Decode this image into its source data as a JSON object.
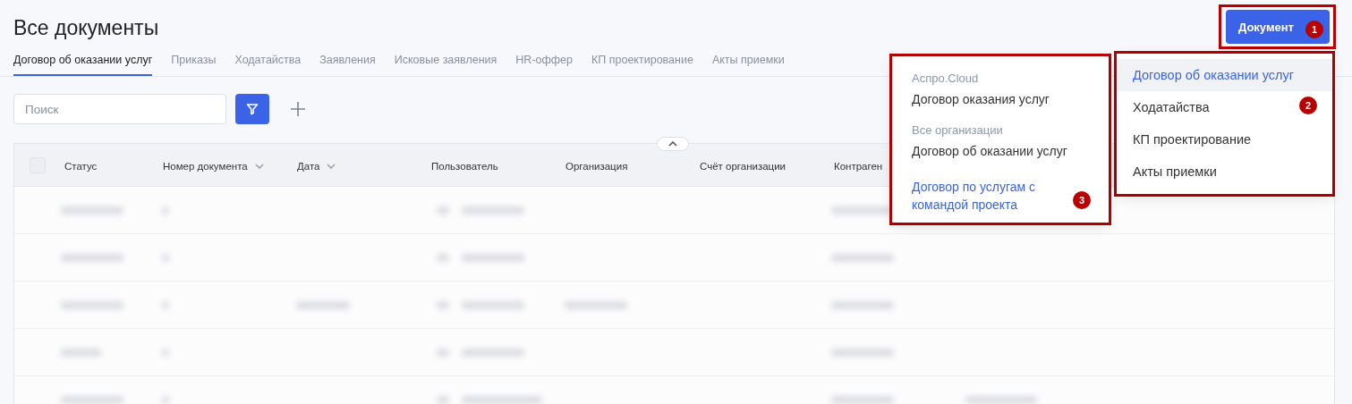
{
  "page": {
    "title": "Все документы"
  },
  "tabs": [
    {
      "label": "Договор об оказании услуг",
      "selected": true
    },
    {
      "label": "Приказы",
      "selected": false
    },
    {
      "label": "Ходатайства",
      "selected": false
    },
    {
      "label": "Заявления",
      "selected": false
    },
    {
      "label": "Исковые заявления",
      "selected": false
    },
    {
      "label": "HR-оффер",
      "selected": false
    },
    {
      "label": "КП проектирование",
      "selected": false
    },
    {
      "label": "Акты приемки",
      "selected": false
    }
  ],
  "search": {
    "placeholder": "Поиск"
  },
  "table": {
    "header_checkbox": {
      "checked": false
    },
    "columns": [
      {
        "label": "Статус",
        "sortable": false
      },
      {
        "label": "Номер документа",
        "sortable": true
      },
      {
        "label": "Дата",
        "sortable": true
      },
      {
        "label": "Пользователь",
        "sortable": false
      },
      {
        "label": "Организация",
        "sortable": false
      },
      {
        "label": "Счёт организации",
        "sortable": false
      },
      {
        "label": "Контраген",
        "sortable": false
      }
    ]
  },
  "create_button": {
    "label": "Документ"
  },
  "template_menu": {
    "items": [
      {
        "label": "Договор об оказании услуг",
        "selected": true
      },
      {
        "label": "Ходатайства",
        "selected": false
      },
      {
        "label": "КП проектирование",
        "selected": false
      },
      {
        "label": "Акты приемки",
        "selected": false
      }
    ]
  },
  "organization_menu": {
    "groups": [
      {
        "label": "Аспро.Cloud",
        "items": [
          {
            "label": "Договор оказания услуг",
            "selected": false
          }
        ]
      },
      {
        "label": "Все организации",
        "items": [
          {
            "label": "Договор об оказании услуг",
            "selected": false
          },
          {
            "label": "Договор по услугам с командой проекта",
            "selected": true
          }
        ]
      }
    ]
  },
  "annotations": [
    {
      "label": "1"
    },
    {
      "label": "2"
    },
    {
      "label": "3"
    }
  ]
}
